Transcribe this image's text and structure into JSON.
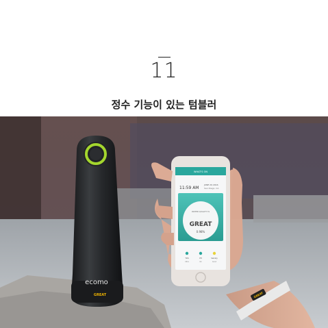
{
  "section": {
    "number": "11",
    "title": "정수 기능이 있는 텀블러"
  },
  "photo": {
    "bottle_brand": "ecomo",
    "bottle_badge": "GREAT",
    "phone": {
      "header": "WHAT'S ON",
      "time": "11:59 AM",
      "date": "JUNE 29 2016",
      "location": "San Diego, CA",
      "card_label": "WATER QUALITY IS",
      "status": "GREAT",
      "percent": "0.98%",
      "stats": [
        "TDS",
        "PH",
        "Salinity"
      ],
      "stat_values": [
        "Ultra",
        "Ok",
        "Good"
      ]
    },
    "band_label": "GREAT",
    "colors": {
      "ring": "#a4d62e",
      "card": "#3bb3a8",
      "band": "#f0b400"
    }
  }
}
